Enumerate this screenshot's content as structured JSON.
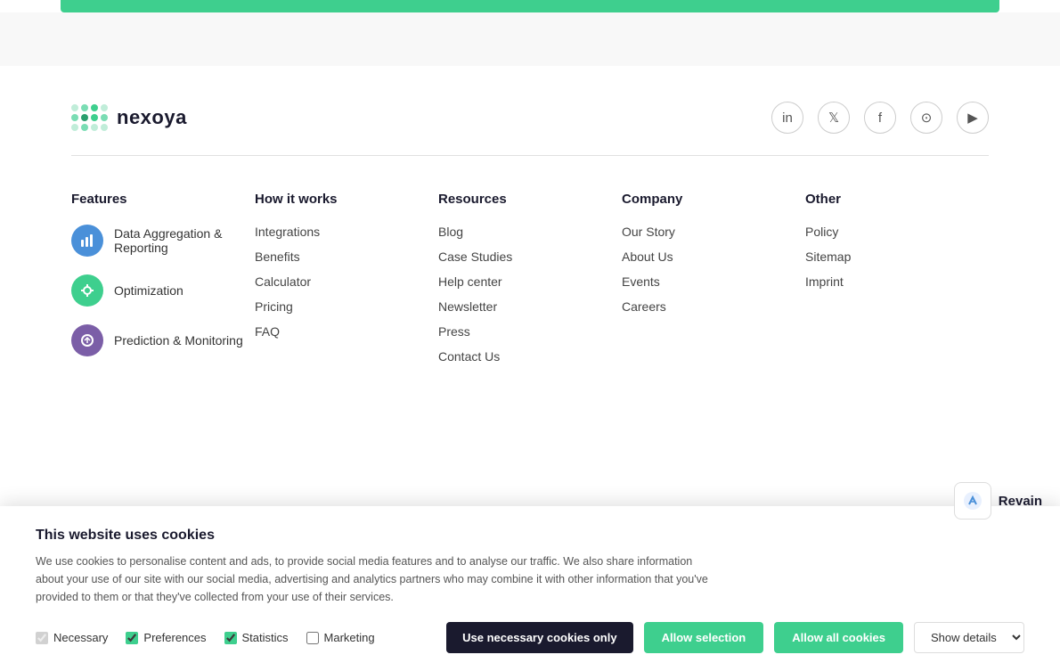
{
  "topBar": {
    "color": "#3ecf8e"
  },
  "logo": {
    "name": "nexoya",
    "tagline": ""
  },
  "socialIcons": [
    {
      "name": "linkedin-icon",
      "symbol": "in"
    },
    {
      "name": "twitter-icon",
      "symbol": "𝕏"
    },
    {
      "name": "facebook-icon",
      "symbol": "f"
    },
    {
      "name": "instagram-icon",
      "symbol": "◉"
    },
    {
      "name": "youtube-icon",
      "symbol": "▶"
    }
  ],
  "footer": {
    "columns": [
      {
        "title": "Features",
        "type": "features",
        "items": [
          {
            "label": "Data Aggregation & Reporting",
            "icon": "chart-icon",
            "iconColor": "blue"
          },
          {
            "label": "Optimization",
            "icon": "optimization-icon",
            "iconColor": "green"
          },
          {
            "label": "Prediction & Monitoring",
            "icon": "prediction-icon",
            "iconColor": "purple"
          }
        ]
      },
      {
        "title": "How it works",
        "type": "links",
        "items": [
          {
            "label": "Integrations"
          },
          {
            "label": "Benefits"
          },
          {
            "label": "Calculator"
          },
          {
            "label": "Pricing"
          },
          {
            "label": "FAQ"
          }
        ]
      },
      {
        "title": "Resources",
        "type": "links",
        "items": [
          {
            "label": "Blog"
          },
          {
            "label": "Case Studies"
          },
          {
            "label": "Help center"
          },
          {
            "label": "Newsletter"
          },
          {
            "label": "Press"
          },
          {
            "label": "Contact Us"
          }
        ]
      },
      {
        "title": "Company",
        "type": "links",
        "items": [
          {
            "label": "Our Story"
          },
          {
            "label": "About Us"
          },
          {
            "label": "Events"
          },
          {
            "label": "Careers"
          }
        ]
      },
      {
        "title": "Other",
        "type": "links",
        "items": [
          {
            "label": "Policy"
          },
          {
            "label": "Sitemap"
          },
          {
            "label": "Imprint"
          }
        ]
      }
    ]
  },
  "cookie": {
    "title": "This website uses cookies",
    "description": "We use cookies to personalise content and ads, to provide social media features and to analyse our traffic. We also share information about your use of our site with our social media, advertising and analytics partners who may combine it with other information that you've provided to them or that they've collected from your use of their services.",
    "checkboxes": [
      {
        "label": "Necessary",
        "checked": true,
        "disabled": true
      },
      {
        "label": "Preferences",
        "checked": true
      },
      {
        "label": "Statistics",
        "checked": true
      },
      {
        "label": "Marketing",
        "checked": false
      }
    ],
    "buttons": {
      "necessary": "Use necessary cookies only",
      "selection": "Allow selection",
      "all": "Allow all cookies"
    },
    "showDetails": "Show details"
  },
  "revain": {
    "label": "Revain"
  }
}
